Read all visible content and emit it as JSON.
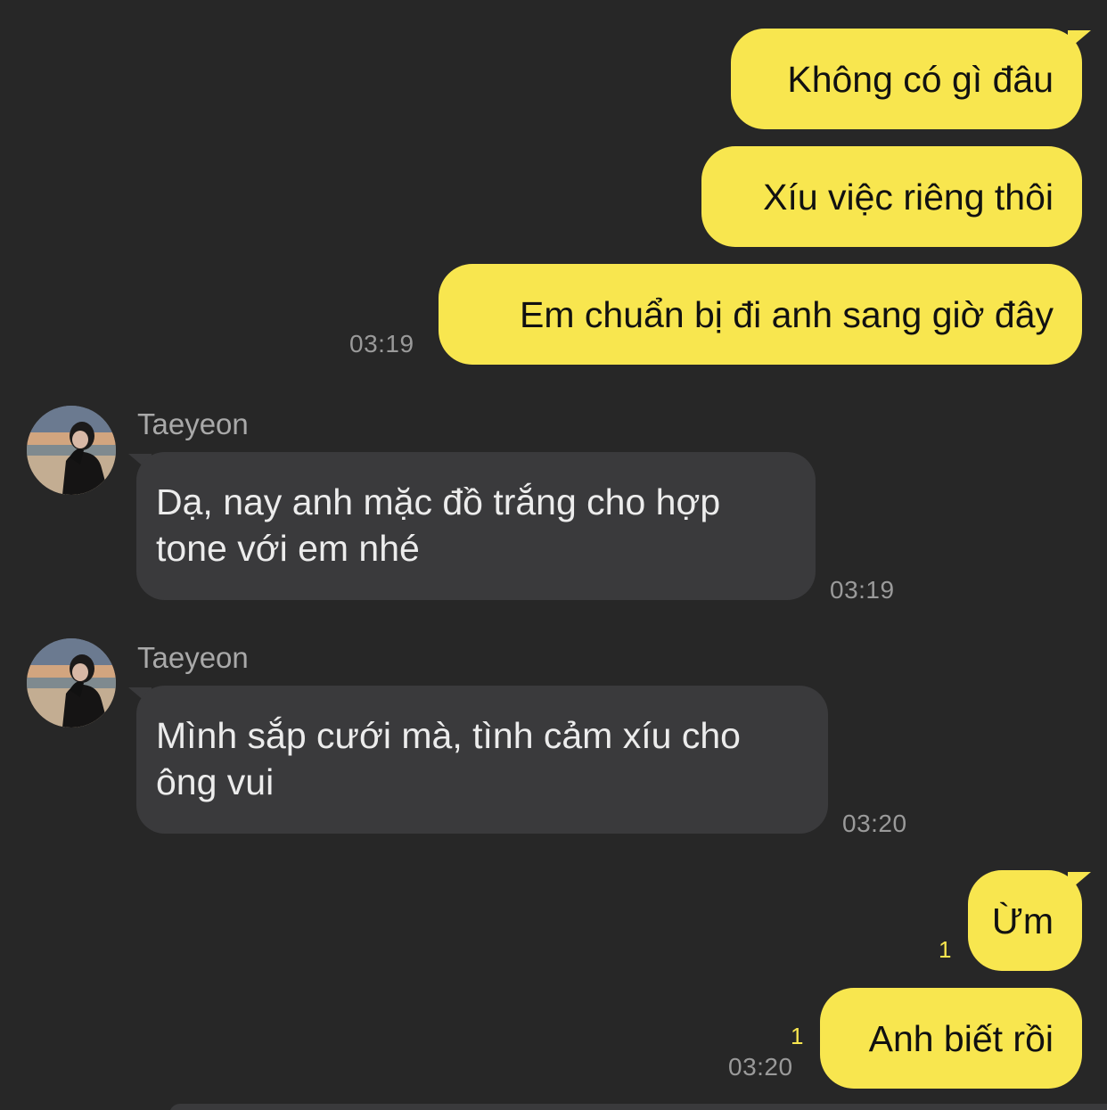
{
  "colors": {
    "background": "#272727",
    "outgoing_bubble": "#f8e64f",
    "incoming_bubble": "#3a3a3c",
    "timestamp": "#9a9a9a",
    "unread_count": "#f8e64f"
  },
  "messages": [
    {
      "direction": "outgoing",
      "text": "Không có gì đâu"
    },
    {
      "direction": "outgoing",
      "text": "Xíu việc riêng thôi"
    },
    {
      "direction": "outgoing",
      "text": "Em chuẩn bị đi anh sang giờ đây",
      "time": "03:19"
    },
    {
      "direction": "incoming",
      "sender": "Taeyeon",
      "avatar_icon": "profile-photo",
      "text": "Dạ, nay anh mặc đồ trắng cho hợp tone với em nhé",
      "time": "03:19"
    },
    {
      "direction": "incoming",
      "sender": "Taeyeon",
      "avatar_icon": "profile-photo",
      "text": "Mình sắp cưới mà, tình cảm xíu cho ông vui",
      "time": "03:20"
    },
    {
      "direction": "outgoing",
      "text": "Ừm",
      "unread": "1"
    },
    {
      "direction": "outgoing",
      "text": "Anh biết rồi",
      "unread": "1",
      "time": "03:20"
    }
  ]
}
